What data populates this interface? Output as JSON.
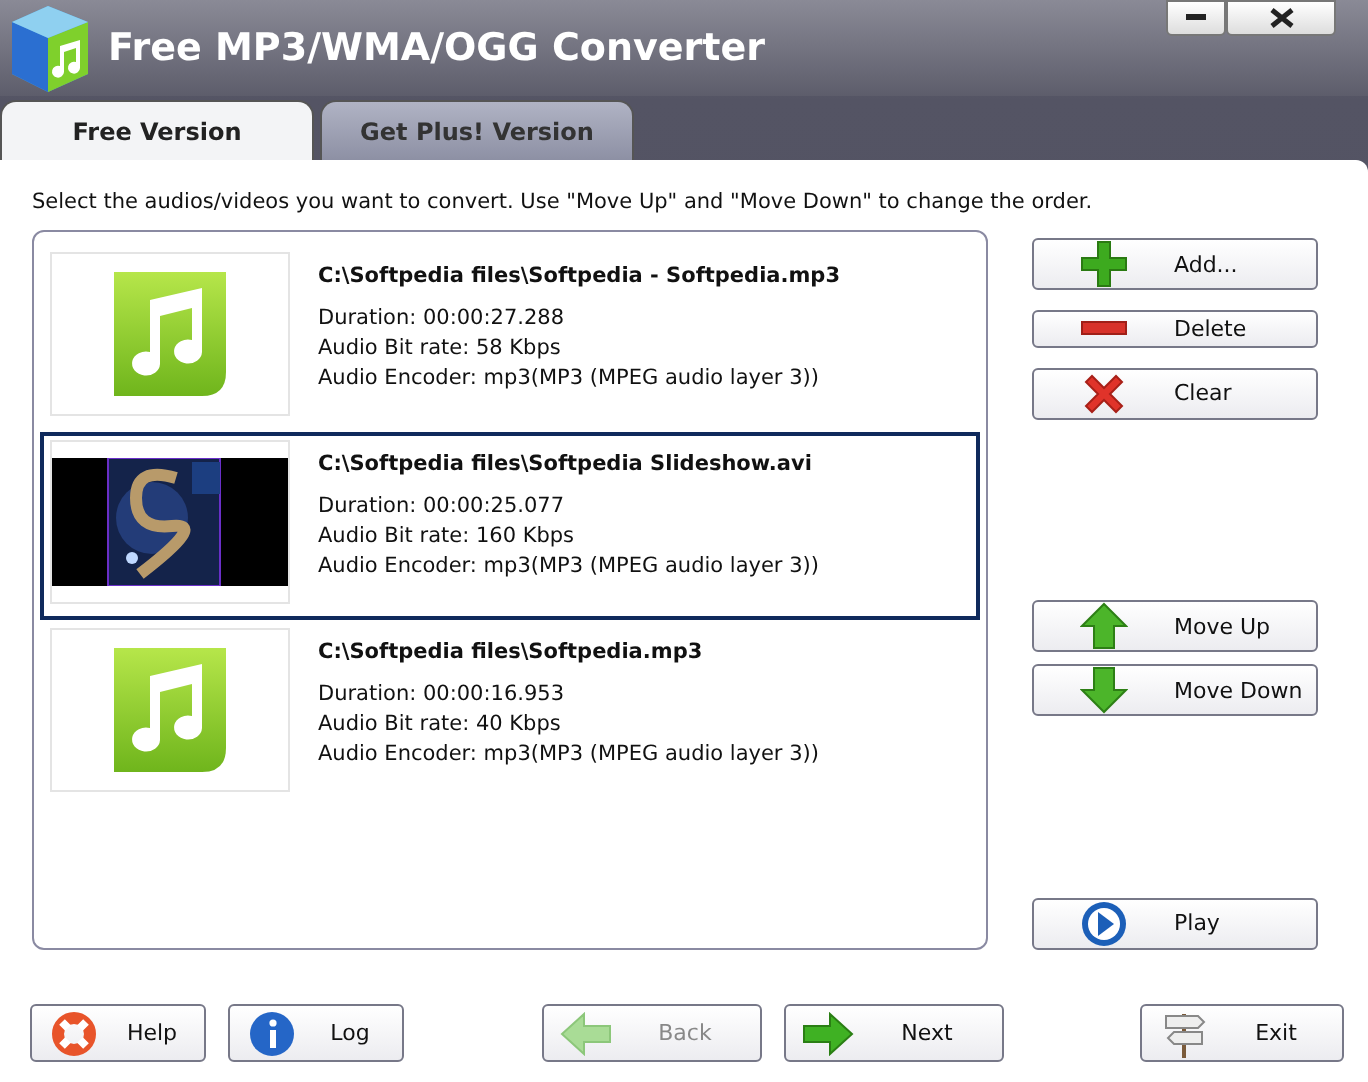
{
  "window": {
    "title": "Free MP3/WMA/OGG Converter"
  },
  "tabs": [
    {
      "label": "Free Version",
      "selected": true
    },
    {
      "label": "Get Plus! Version",
      "selected": false
    }
  ],
  "instruction": "Select the audios/videos you want to convert. Use \"Move Up\" and \"Move Down\" to change the order.",
  "files": [
    {
      "kind": "audio",
      "path": "C:\\Softpedia files\\Softpedia - Softpedia.mp3",
      "duration": "Duration: 00:00:27.288",
      "bitrate": "Audio Bit rate: 58 Kbps",
      "encoder": "Audio Encoder: mp3(MP3 (MPEG audio layer 3))",
      "selected": false
    },
    {
      "kind": "video",
      "path": "C:\\Softpedia files\\Softpedia Slideshow.avi",
      "duration": "Duration: 00:00:25.077",
      "bitrate": "Audio Bit rate: 160 Kbps",
      "encoder": "Audio Encoder: mp3(MP3 (MPEG audio layer 3))",
      "selected": true
    },
    {
      "kind": "audio",
      "path": "C:\\Softpedia files\\Softpedia.mp3",
      "duration": "Duration: 00:00:16.953",
      "bitrate": "Audio Bit rate: 40 Kbps",
      "encoder": "Audio Encoder: mp3(MP3 (MPEG audio layer 3))",
      "selected": false
    }
  ],
  "side_buttons": [
    {
      "kind": "add",
      "label": "Add..."
    },
    {
      "kind": "delete",
      "label": "Delete"
    },
    {
      "kind": "clear",
      "label": "Clear"
    },
    {
      "kind": "spacer"
    },
    {
      "kind": "up",
      "label": "Move Up"
    },
    {
      "kind": "down",
      "label": "Move Down"
    },
    {
      "kind": "spacer"
    },
    {
      "kind": "play",
      "label": "Play"
    }
  ],
  "bottom_buttons": [
    {
      "kind": "help",
      "label": "Help",
      "disabled": false
    },
    {
      "kind": "log",
      "label": "Log",
      "disabled": false
    },
    {
      "kind": "spacer"
    },
    {
      "kind": "back",
      "label": "Back",
      "disabled": true
    },
    {
      "kind": "next",
      "label": "Next",
      "disabled": false
    },
    {
      "kind": "spacer"
    },
    {
      "kind": "exit",
      "label": "Exit",
      "disabled": false
    }
  ]
}
